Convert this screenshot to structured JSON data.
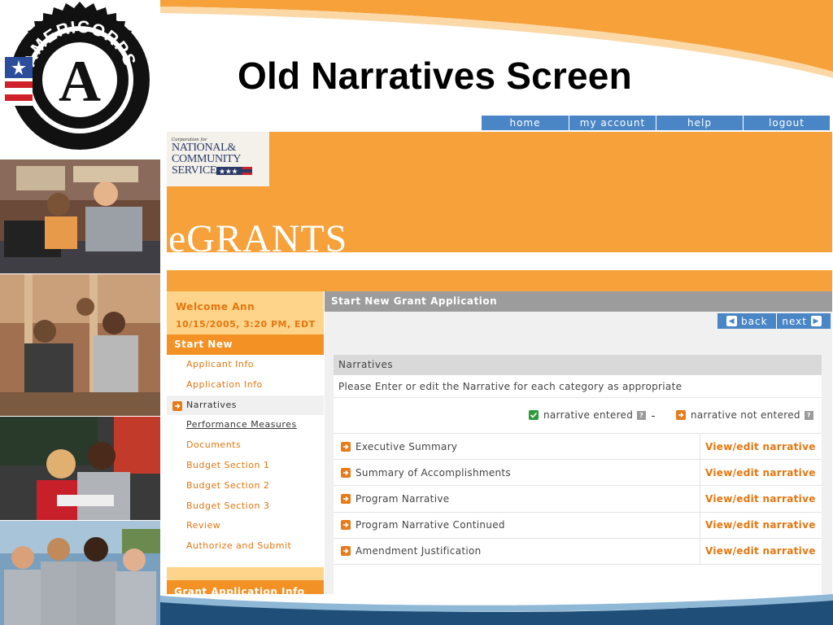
{
  "slide": {
    "title": "Old Narratives Screen",
    "colors": {
      "orange": "#f6a13a",
      "blue": "#4a86c5",
      "navy": "#1f4f78"
    }
  },
  "logo": {
    "name": "AMERICORPS",
    "letter": "A"
  },
  "topnav": [
    {
      "label": "home"
    },
    {
      "label": "my account"
    },
    {
      "label": "help"
    },
    {
      "label": "logout"
    }
  ],
  "banner": {
    "org_small": "Corporation for",
    "org_line1": "NATIONAL&",
    "org_line2": "COMMUNITY",
    "org_line3": "SERVICE",
    "app_name": "eGRANTS"
  },
  "sidebar": {
    "welcome": "Welcome Ann",
    "datetime": "10/15/2005, 3:20 PM, EDT",
    "section_title": "Start New",
    "items": [
      {
        "label": "Applicant Info"
      },
      {
        "label": "Application Info"
      },
      {
        "label": "Narratives"
      },
      {
        "label": "Performance Measures"
      },
      {
        "label": "Documents"
      },
      {
        "label": "Budget Section 1"
      },
      {
        "label": "Budget Section 2"
      },
      {
        "label": "Budget Section 3"
      },
      {
        "label": "Review"
      },
      {
        "label": "Authorize and Submit"
      }
    ],
    "section2_title": "Grant Application Info"
  },
  "main": {
    "title": "Start New Grant Application",
    "back_label": "back",
    "next_label": "next",
    "panel_title": "Narratives",
    "instructions": "Please Enter or edit the Narrative for each category as appropriate",
    "legend_entered": "narrative entered",
    "legend_not_entered": "narrative not entered",
    "help_glyph": "?",
    "rows": [
      {
        "label": "Executive Summary",
        "action": "View/edit narrative"
      },
      {
        "label": "Summary of Accomplishments",
        "action": "View/edit narrative"
      },
      {
        "label": "Program Narrative",
        "action": "View/edit narrative"
      },
      {
        "label": "Program Narrative Continued",
        "action": "View/edit narrative"
      },
      {
        "label": "Amendment Justification",
        "action": "View/edit narrative"
      }
    ]
  }
}
